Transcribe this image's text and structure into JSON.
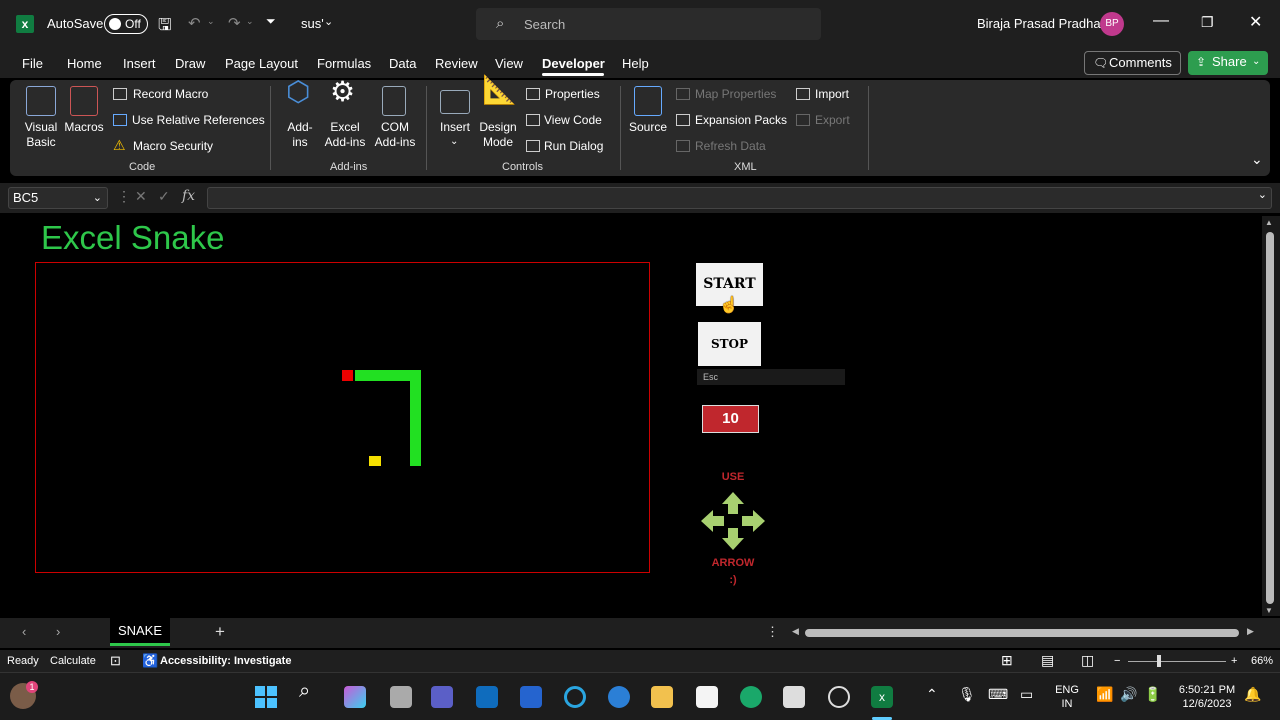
{
  "titlebar": {
    "autosave_label": "AutoSave",
    "autosave_state": "Off",
    "filename": "sus'",
    "search_placeholder": "Search",
    "user_name": "Biraja Prasad Pradhan",
    "user_initials": "BP"
  },
  "menu": {
    "tabs": [
      "File",
      "Home",
      "Insert",
      "Draw",
      "Page Layout",
      "Formulas",
      "Data",
      "Review",
      "View",
      "Developer",
      "Help"
    ],
    "active": "Developer",
    "comments_label": "Comments",
    "share_label": "Share"
  },
  "ribbon": {
    "code": {
      "visual_basic": "Visual Basic",
      "macros": "Macros",
      "record_macro": "Record Macro",
      "relative_refs": "Use Relative References",
      "macro_security": "Macro Security",
      "label": "Code"
    },
    "addins": {
      "addins": "Add-ins",
      "excel_addins": "Excel Add-ins",
      "com_addins": "COM Add-ins",
      "label": "Add-ins"
    },
    "controls": {
      "insert": "Insert",
      "design_mode": "Design Mode",
      "properties": "Properties",
      "view_code": "View Code",
      "run_dialog": "Run Dialog",
      "label": "Controls"
    },
    "xml": {
      "source": "Source",
      "map_properties": "Map Properties",
      "expansion_packs": "Expansion Packs",
      "refresh_data": "Refresh Data",
      "import": "Import",
      "export": "Export",
      "label": "XML"
    }
  },
  "formula_bar": {
    "name_box": "BC5",
    "fx": "fx",
    "value": ""
  },
  "game": {
    "title": "Excel Snake",
    "start_label": "START",
    "stop_label": "STOP",
    "esc_hint": "Esc",
    "score": "10",
    "use_label": "USE",
    "arrow_label": "ARROW",
    "smiley": ":)",
    "colors": {
      "snake": "#22e022",
      "head": "#e00000",
      "food": "#f5e000",
      "border": "#cc0000"
    }
  },
  "sheets": {
    "tabs": [
      "SNAKE"
    ],
    "active": "SNAKE"
  },
  "status": {
    "ready": "Ready",
    "calculate": "Calculate",
    "accessibility": "Accessibility: Investigate",
    "zoom": "66%"
  },
  "taskbar": {
    "language_line1": "ENG",
    "language_line2": "IN",
    "time": "6:50:21 PM",
    "date": "12/6/2023",
    "notification_count": "1"
  }
}
